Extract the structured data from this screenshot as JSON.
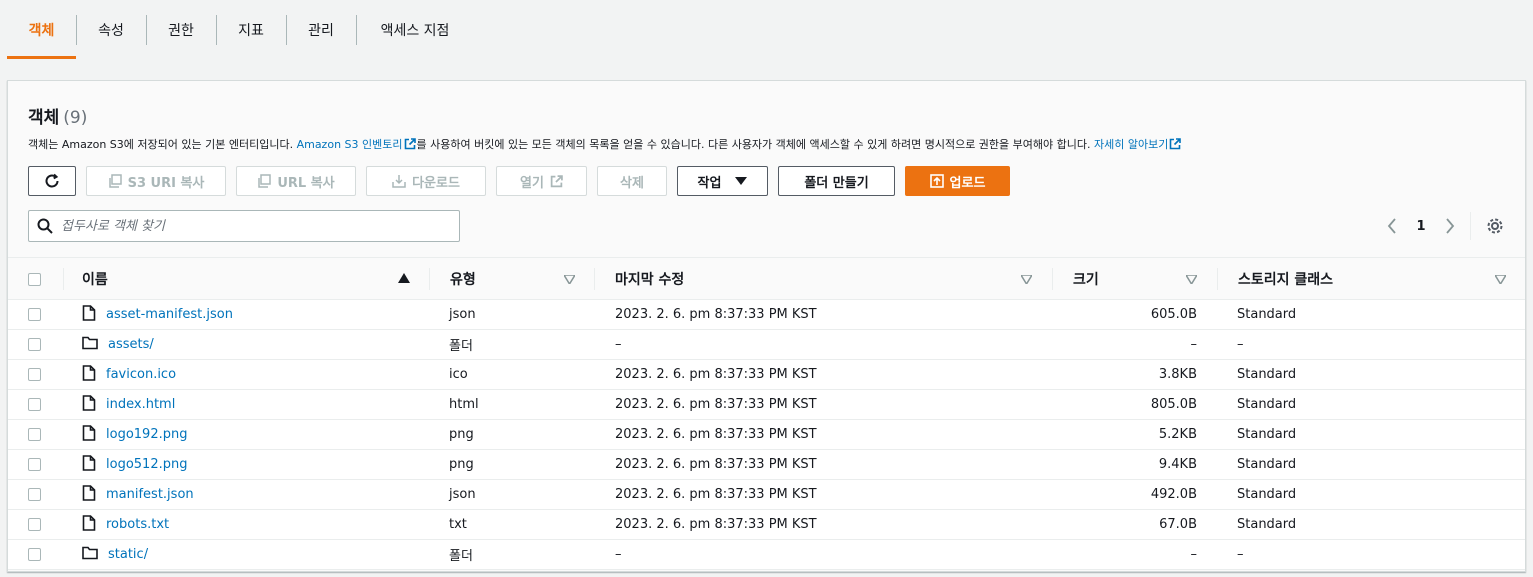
{
  "tabs": [
    {
      "label": "객체",
      "active": true
    },
    {
      "label": "속성"
    },
    {
      "label": "권한"
    },
    {
      "label": "지표"
    },
    {
      "label": "관리"
    },
    {
      "label": "액세스 지점"
    }
  ],
  "panel": {
    "title": "객체",
    "count": "(9)",
    "desc_part1": "객체는 Amazon S3에 저장되어 있는 기본 엔터티입니다. ",
    "desc_link1": "Amazon S3 인벤토리",
    "desc_part2": "를 사용하여 버킷에 있는 모든 객체의 목록을 얻을 수 있습니다. 다른 사용자가 객체에 액세스할 수 있게 하려면 명시적으로 권한을 부여해야 합니다. ",
    "desc_link2": "자세히 알아보기"
  },
  "toolbar": {
    "refresh_icon": "refresh-icon",
    "copy_s3_uri": "S3 URI 복사",
    "copy_url": "URL 복사",
    "download": "다운로드",
    "open": "열기",
    "delete": "삭제",
    "actions": "작업",
    "create_folder": "폴더 만들기",
    "upload": "업로드"
  },
  "search": {
    "placeholder": "접두사로 객체 찾기"
  },
  "pagination": {
    "page": "1"
  },
  "accent_color": "#ec7211",
  "link_color": "#0073bb",
  "table": {
    "columns": {
      "name": "이름",
      "type": "유형",
      "modified": "마지막 수정",
      "size": "크기",
      "storage": "스토리지 클래스"
    },
    "rows": [
      {
        "icon": "file-icon",
        "name": "asset-manifest.json",
        "type": "json",
        "modified": "2023. 2. 6. pm 8:37:33 PM KST",
        "size": "605.0B",
        "storage": "Standard"
      },
      {
        "icon": "folder-icon",
        "name": "assets/",
        "type": "폴더",
        "modified": "–",
        "size": "–",
        "storage": "–"
      },
      {
        "icon": "file-icon",
        "name": "favicon.ico",
        "type": "ico",
        "modified": "2023. 2. 6. pm 8:37:33 PM KST",
        "size": "3.8KB",
        "storage": "Standard"
      },
      {
        "icon": "file-icon",
        "name": "index.html",
        "type": "html",
        "modified": "2023. 2. 6. pm 8:37:33 PM KST",
        "size": "805.0B",
        "storage": "Standard"
      },
      {
        "icon": "file-icon",
        "name": "logo192.png",
        "type": "png",
        "modified": "2023. 2. 6. pm 8:37:33 PM KST",
        "size": "5.2KB",
        "storage": "Standard"
      },
      {
        "icon": "file-icon",
        "name": "logo512.png",
        "type": "png",
        "modified": "2023. 2. 6. pm 8:37:33 PM KST",
        "size": "9.4KB",
        "storage": "Standard"
      },
      {
        "icon": "file-icon",
        "name": "manifest.json",
        "type": "json",
        "modified": "2023. 2. 6. pm 8:37:33 PM KST",
        "size": "492.0B",
        "storage": "Standard"
      },
      {
        "icon": "file-icon",
        "name": "robots.txt",
        "type": "txt",
        "modified": "2023. 2. 6. pm 8:37:33 PM KST",
        "size": "67.0B",
        "storage": "Standard"
      },
      {
        "icon": "folder-icon",
        "name": "static/",
        "type": "폴더",
        "modified": "–",
        "size": "–",
        "storage": "–"
      }
    ]
  }
}
